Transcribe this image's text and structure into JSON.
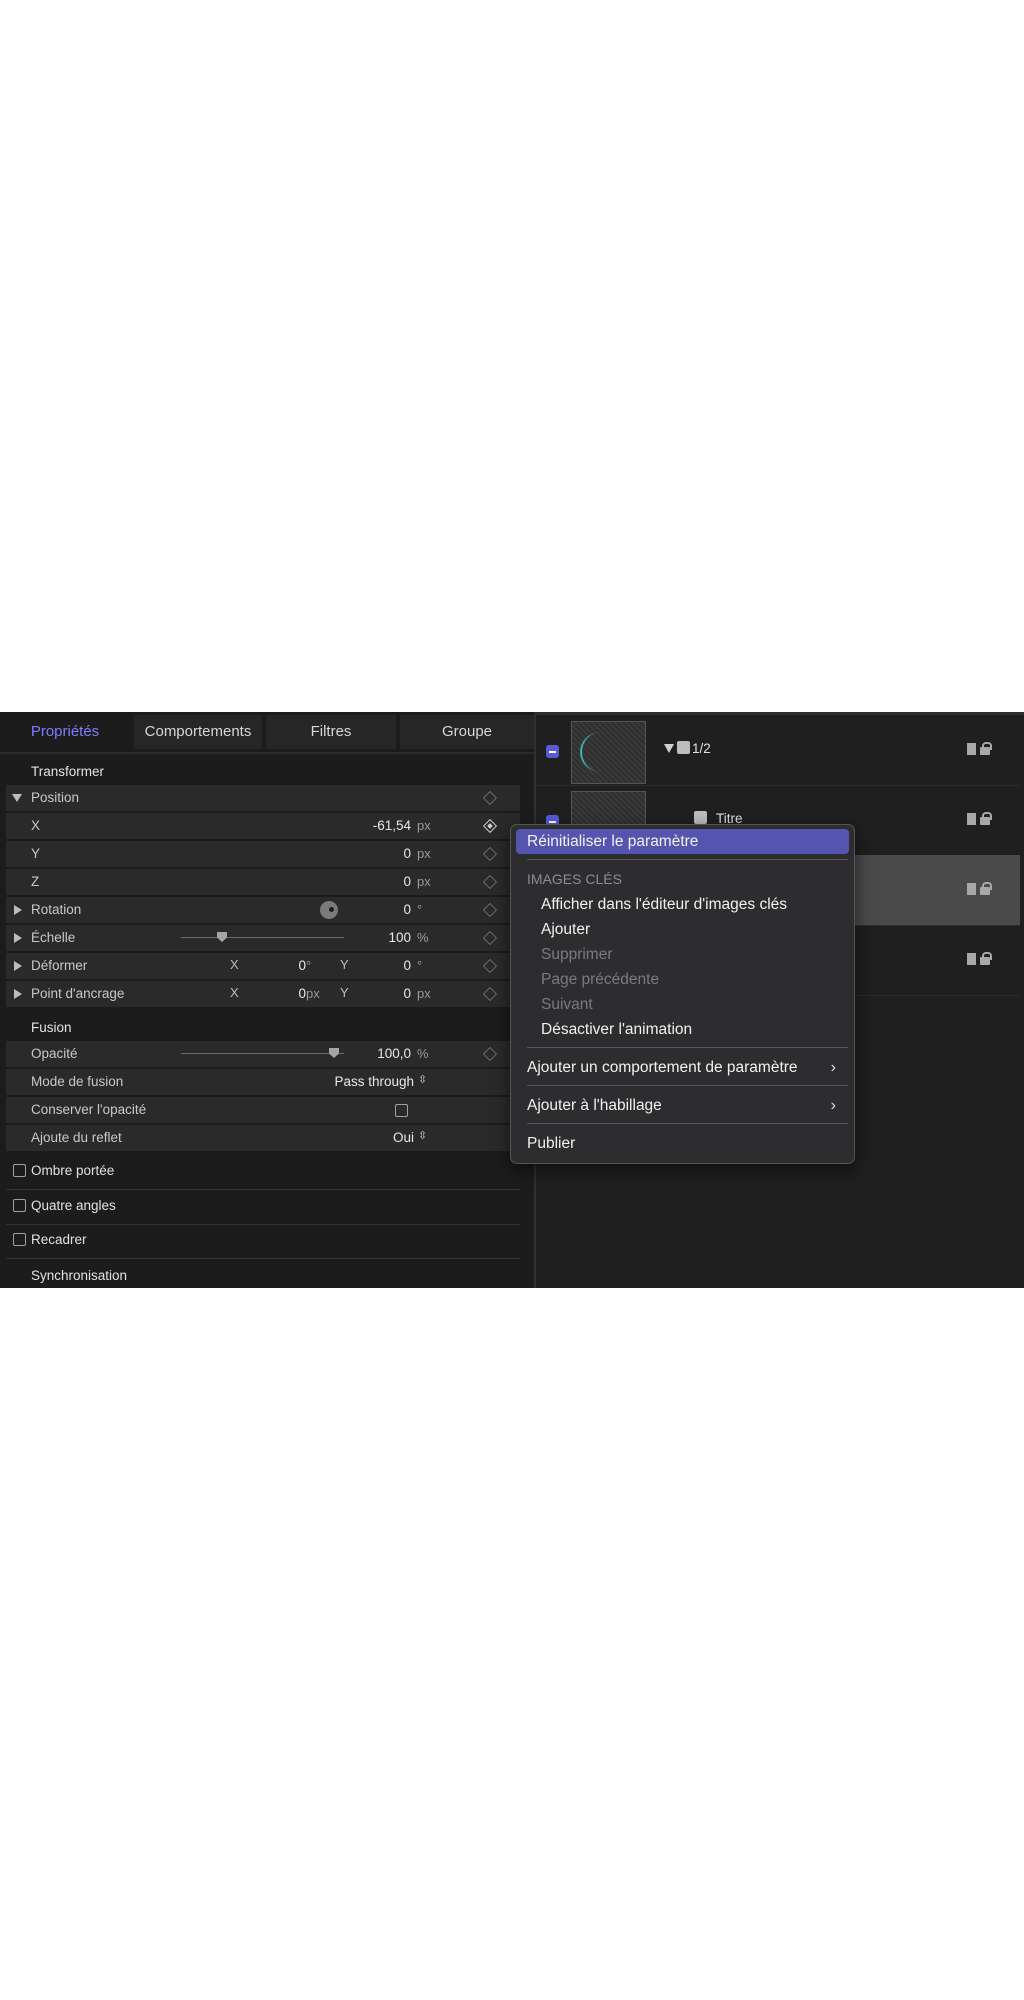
{
  "tabs": [
    "Propriétés",
    "Comportements",
    "Filtres",
    "Groupe"
  ],
  "inspector": {
    "transform_title": "Transformer",
    "position_label": "Position",
    "x_label": "X",
    "x_value": "-61,54",
    "x_unit": "px",
    "y_label": "Y",
    "y_value": "0",
    "y_unit": "px",
    "z_label": "Z",
    "z_value": "0",
    "z_unit": "px",
    "rotation_label": "Rotation",
    "rotation_value": "0",
    "rotation_unit": "°",
    "scale_label": "Échelle",
    "scale_value": "100",
    "scale_unit": "%",
    "distort_label": "Déformer",
    "distort_x_label": "X",
    "distort_x_value": "0",
    "distort_x_unit": "°",
    "distort_y_label": "Y",
    "distort_y_value": "0",
    "distort_y_unit": "°",
    "anchor_label": "Point d'ancrage",
    "anchor_x_label": "X",
    "anchor_x_value": "0",
    "anchor_x_unit": "px",
    "anchor_y_label": "Y",
    "anchor_y_value": "0",
    "anchor_y_unit": "px",
    "blend_title": "Fusion",
    "opacity_label": "Opacité",
    "opacity_value": "100,0",
    "opacity_unit": "%",
    "blend_mode_label": "Mode de fusion",
    "blend_mode_value": "Pass through",
    "preserve_opacity_label": "Conserver l'opacité",
    "reflection_label": "Ajoute du reflet",
    "reflection_value": "Oui",
    "drop_shadow_label": "Ombre portée",
    "four_corner_label": "Quatre angles",
    "crop_label": "Recadrer",
    "timing_title": "Synchronisation"
  },
  "layers": {
    "items": [
      {
        "name": "1/2"
      },
      {
        "name": "Titre"
      },
      {
        "name": ""
      },
      {
        "name": ""
      }
    ]
  },
  "context_menu": {
    "reset": "Réinitialiser le paramètre",
    "keyframes_header": "IMAGES CLÉS",
    "show_in_editor": "Afficher dans l'éditeur d'images clés",
    "add": "Ajouter",
    "delete": "Supprimer",
    "previous": "Page précédente",
    "next": "Suivant",
    "disable_animation": "Désactiver l'animation",
    "add_param_behavior": "Ajouter un comportement de paramètre",
    "add_to_rig": "Ajouter à l'habillage",
    "publish": "Publier"
  },
  "colors": {
    "accent": "#7d7dff",
    "highlight": "#5555b0",
    "layer_check": "#5a5ad6"
  }
}
